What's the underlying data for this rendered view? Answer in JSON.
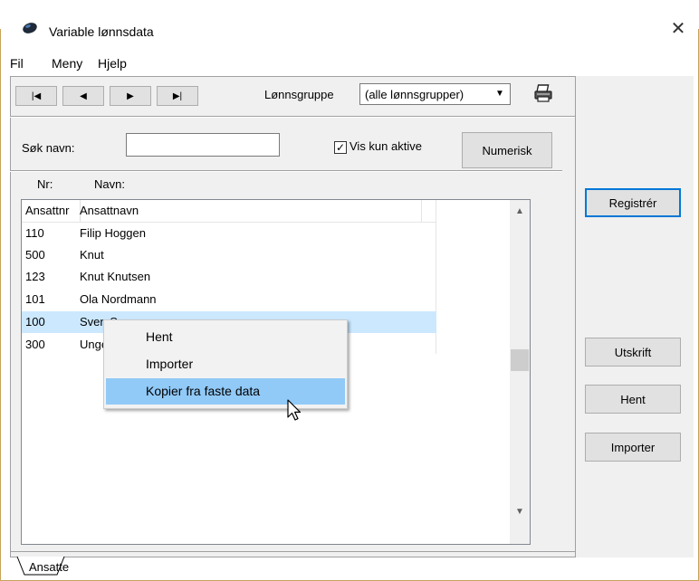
{
  "window": {
    "title": "Variable lønnsdata",
    "close_glyph": "✕"
  },
  "menu": [
    "Fil",
    "Meny",
    "Hjelp"
  ],
  "nav": {
    "first": "|◀",
    "prev": "◀",
    "next": "▶",
    "last": "▶|"
  },
  "toolbar": {
    "group_label": "Lønnsgruppe",
    "group_value": "(alle lønnsgrupper)",
    "combo_arrow": "▼"
  },
  "search": {
    "label": "Søk navn:",
    "value": "",
    "checkbox_label": "Vis kun aktive",
    "checkbox_mark": "✓",
    "numerisk": "Numerisk"
  },
  "columns_top": {
    "nr": "Nr:",
    "navn": "Navn:"
  },
  "table": {
    "headers": [
      "Ansattnr",
      "Ansattnavn"
    ],
    "rows": [
      [
        "110",
        "Filip Hoggen"
      ],
      [
        "500",
        "Knut"
      ],
      [
        "123",
        "Knut Knutsen"
      ],
      [
        "101",
        "Ola Nordmann"
      ],
      [
        "100",
        "Sven Svensson"
      ],
      [
        "300",
        "Unge Ungdom"
      ]
    ],
    "selected_row": 4
  },
  "context_menu": [
    "Hent",
    "Importer",
    "Kopier fra faste data"
  ],
  "right_buttons": {
    "registrer": "Registrér",
    "utskrift": "Utskrift",
    "hent": "Hent",
    "importer": "Importer"
  },
  "scroll": {
    "up": "▲",
    "down": "▼"
  },
  "tabs": [
    "Ansatte"
  ]
}
